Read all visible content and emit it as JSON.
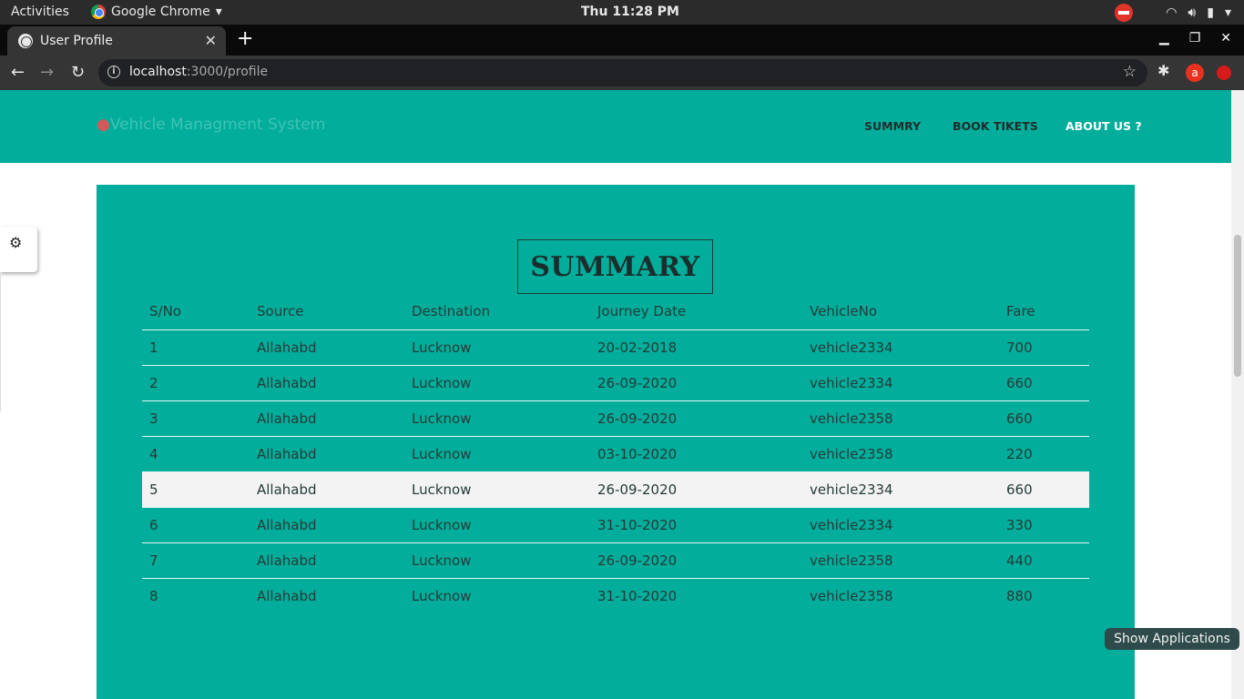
{
  "system": {
    "activities": "Activities",
    "app_name": "Google Chrome",
    "clock": "Thu 11:28 PM"
  },
  "browser": {
    "tab_title": "User Profile",
    "url_host": "localhost",
    "url_rest": ":3000/profile",
    "profile_initial": "a"
  },
  "site": {
    "brand": "Vehicle Managment System",
    "nav": [
      "SUMMRY",
      "BOOK TIKETS",
      "ABOUT US ?"
    ]
  },
  "summary": {
    "title": "SUMMARY",
    "columns": [
      "S/No",
      "Source",
      "Destination",
      "Journey Date",
      "VehicleNo",
      "Fare"
    ],
    "rows": [
      [
        "1",
        "Allahabd",
        "Lucknow",
        "20-02-2018",
        "vehicle2334",
        "700"
      ],
      [
        "2",
        "Allahabd",
        "Lucknow",
        "26-09-2020",
        "vehicle2334",
        "660"
      ],
      [
        "3",
        "Allahabd",
        "Lucknow",
        "26-09-2020",
        "vehicle2358",
        "660"
      ],
      [
        "4",
        "Allahabd",
        "Lucknow",
        "03-10-2020",
        "vehicle2358",
        "220"
      ],
      [
        "5",
        "Allahabd",
        "Lucknow",
        "26-09-2020",
        "vehicle2334",
        "660"
      ],
      [
        "6",
        "Allahabd",
        "Lucknow",
        "31-10-2020",
        "vehicle2334",
        "330"
      ],
      [
        "7",
        "Allahabd",
        "Lucknow",
        "26-09-2020",
        "vehicle2358",
        "440"
      ],
      [
        "8",
        "Allahabd",
        "Lucknow",
        "31-10-2020",
        "vehicle2358",
        "880"
      ]
    ]
  },
  "tooltip": "Show Applications",
  "colors": {
    "teal": "#02ad9b",
    "highlight_row": "#f3f3f3"
  },
  "icons": {
    "settings": "gears-icon",
    "star": "bookmark-star-icon",
    "extensions": "puzzle-icon"
  }
}
